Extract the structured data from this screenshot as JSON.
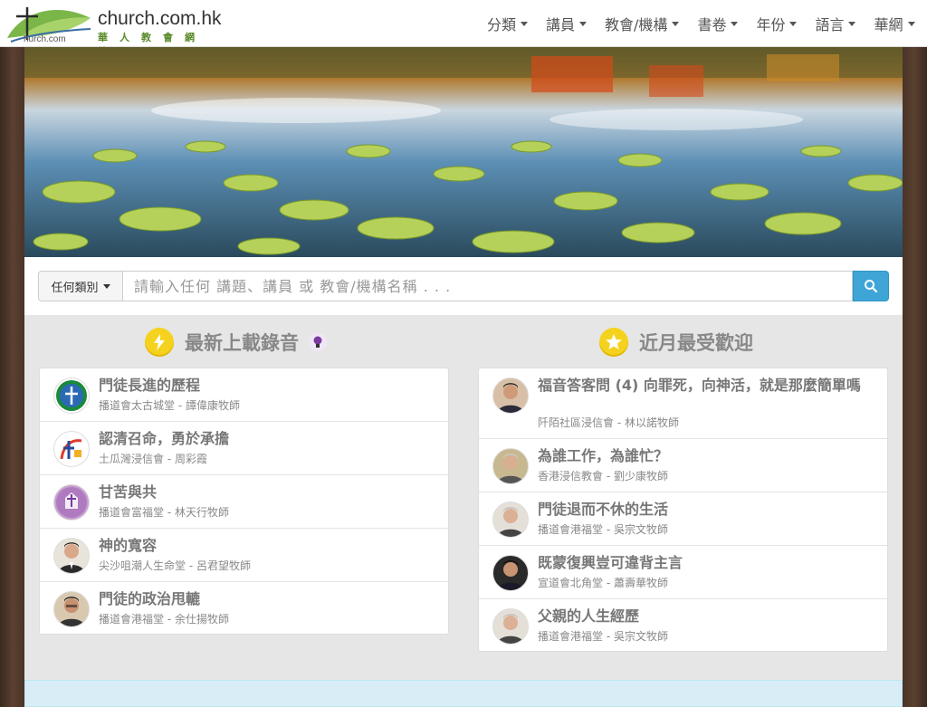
{
  "brand": {
    "title": "church.com.hk",
    "subtitle": "華人教會網絡",
    "small": "hurch.com"
  },
  "nav": {
    "items": [
      "分類",
      "講員",
      "教會/機構",
      "書卷",
      "年份",
      "語言",
      "華網"
    ]
  },
  "search": {
    "category_label": "任何類別",
    "placeholder": "請輸入任何 講題、講員 或 教會/機構名稱 . . .",
    "button_icon": "search-icon"
  },
  "latest": {
    "heading": "最新上載錄音",
    "heading_icon": "lightning-icon",
    "extra_icon": "lightbulb-icon",
    "items": [
      {
        "title": "門徒長進的歷程",
        "subtitle": "播道會太古城堂 - 譚偉康牧師",
        "avatar": "cross-logo-icon"
      },
      {
        "title": "認清召命，勇於承擔",
        "subtitle": "土瓜灣浸信會 - 周彩霞",
        "avatar": "church-logo-icon"
      },
      {
        "title": "甘苦與共",
        "subtitle": "播道會富福堂 - 林天行牧師",
        "avatar": "purple-logo-icon"
      },
      {
        "title": "神的寬容",
        "subtitle": "尖沙咀潮人生命堂 - 呂君望牧師",
        "avatar": "person-photo-icon"
      },
      {
        "title": "門徒的政治甩轆",
        "subtitle": "播道會港福堂 - 余仕揚牧師",
        "avatar": "person-photo-icon"
      }
    ]
  },
  "popular": {
    "heading": "近月最受歡迎",
    "heading_icon": "star-icon",
    "items": [
      {
        "title": "福音答客問 (4) 向罪死，向神活，就是那麼簡單嗎",
        "subtitle": "阡陌社區浸信會 - 林以諾牧師",
        "avatar": "person-photo-icon"
      },
      {
        "title": "為誰工作，為誰忙？",
        "subtitle": "香港浸信教會 - 劉少康牧師",
        "avatar": "person-photo-icon"
      },
      {
        "title": "門徒退而不休的生活",
        "subtitle": "播道會港福堂 - 吳宗文牧師",
        "avatar": "person-photo-icon"
      },
      {
        "title": "既蒙復興豈可違背主言",
        "subtitle": "宣道會北角堂 - 蕭壽華牧師",
        "avatar": "person-photo-icon"
      },
      {
        "title": "父親的人生經歷",
        "subtitle": "播道會港福堂 - 吳宗文牧師",
        "avatar": "person-photo-icon"
      }
    ]
  },
  "colors": {
    "accent": "#3fa5d6",
    "badge": "#f5d21e",
    "logo_green": "#5a8a2a"
  }
}
